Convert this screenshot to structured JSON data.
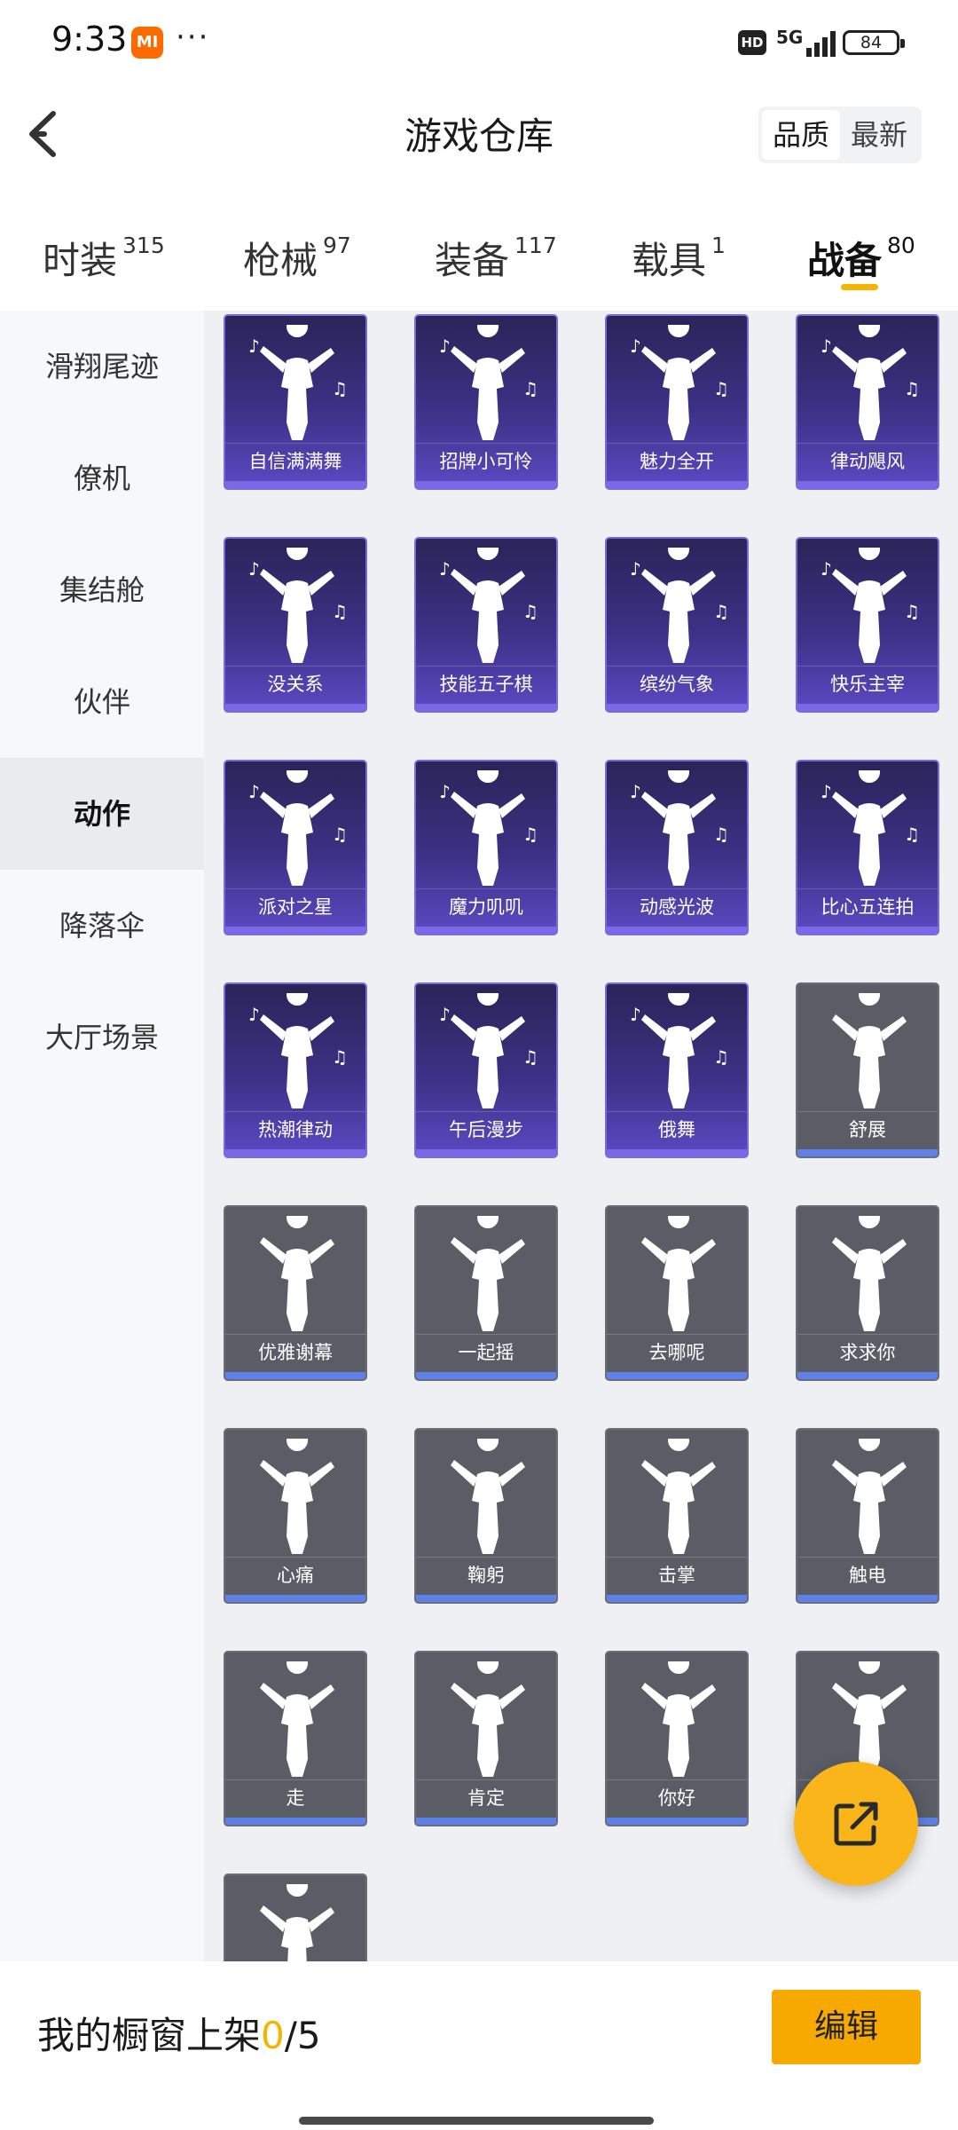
{
  "status": {
    "time": "9:33",
    "mi_badge": "MI",
    "dots": "···",
    "hd": "HD",
    "network": "5G",
    "battery": "84"
  },
  "header": {
    "title": "游戏仓库",
    "sort": {
      "quality": "品质",
      "latest": "最新"
    }
  },
  "tabs": [
    {
      "label": "时装",
      "count": "315"
    },
    {
      "label": "枪械",
      "count": "97"
    },
    {
      "label": "装备",
      "count": "117"
    },
    {
      "label": "载具",
      "count": "1"
    },
    {
      "label": "战备",
      "count": "80"
    }
  ],
  "sidebar": {
    "items": [
      "滑翔尾迹",
      "僚机",
      "集结舱",
      "伙伴",
      "动作",
      "降落伞",
      "大厅场景"
    ],
    "active_index": 4
  },
  "items": [
    {
      "name": "自信满满舞",
      "quality": "purple"
    },
    {
      "name": "招牌小可怜",
      "quality": "purple"
    },
    {
      "name": "魅力全开",
      "quality": "purple"
    },
    {
      "name": "律动飓风",
      "quality": "purple"
    },
    {
      "name": "没关系",
      "quality": "purple"
    },
    {
      "name": "技能五子棋",
      "quality": "purple"
    },
    {
      "name": "缤纷气象",
      "quality": "purple"
    },
    {
      "name": "快乐主宰",
      "quality": "purple"
    },
    {
      "name": "派对之星",
      "quality": "purple"
    },
    {
      "name": "魔力叽叽",
      "quality": "purple"
    },
    {
      "name": "动感光波",
      "quality": "purple"
    },
    {
      "name": "比心五连拍",
      "quality": "purple"
    },
    {
      "name": "热潮律动",
      "quality": "purple"
    },
    {
      "name": "午后漫步",
      "quality": "purple"
    },
    {
      "name": "俄舞",
      "quality": "purple"
    },
    {
      "name": "舒展",
      "quality": "grey"
    },
    {
      "name": "优雅谢幕",
      "quality": "grey"
    },
    {
      "name": "一起摇",
      "quality": "grey"
    },
    {
      "name": "去哪呢",
      "quality": "grey"
    },
    {
      "name": "求求你",
      "quality": "grey"
    },
    {
      "name": "心痛",
      "quality": "grey"
    },
    {
      "name": "鞠躬",
      "quality": "grey"
    },
    {
      "name": "击掌",
      "quality": "grey"
    },
    {
      "name": "触电",
      "quality": "grey"
    },
    {
      "name": "走",
      "quality": "grey"
    },
    {
      "name": "肯定",
      "quality": "grey"
    },
    {
      "name": "你好",
      "quality": "grey"
    },
    {
      "name": "",
      "quality": "grey"
    },
    {
      "name": "",
      "quality": "grey"
    }
  ],
  "bottom": {
    "showcase_label": "我的橱窗上架",
    "showcase_count": "0",
    "showcase_total": "/5",
    "edit_label": "编辑"
  },
  "colors": {
    "accent": "#f5b400",
    "purple_card": "#3c3186",
    "grey_card": "#5a5c66",
    "edit_button": "#f7a900"
  },
  "icons": {
    "back": "chevron-left-icon",
    "share": "share-external-icon"
  }
}
